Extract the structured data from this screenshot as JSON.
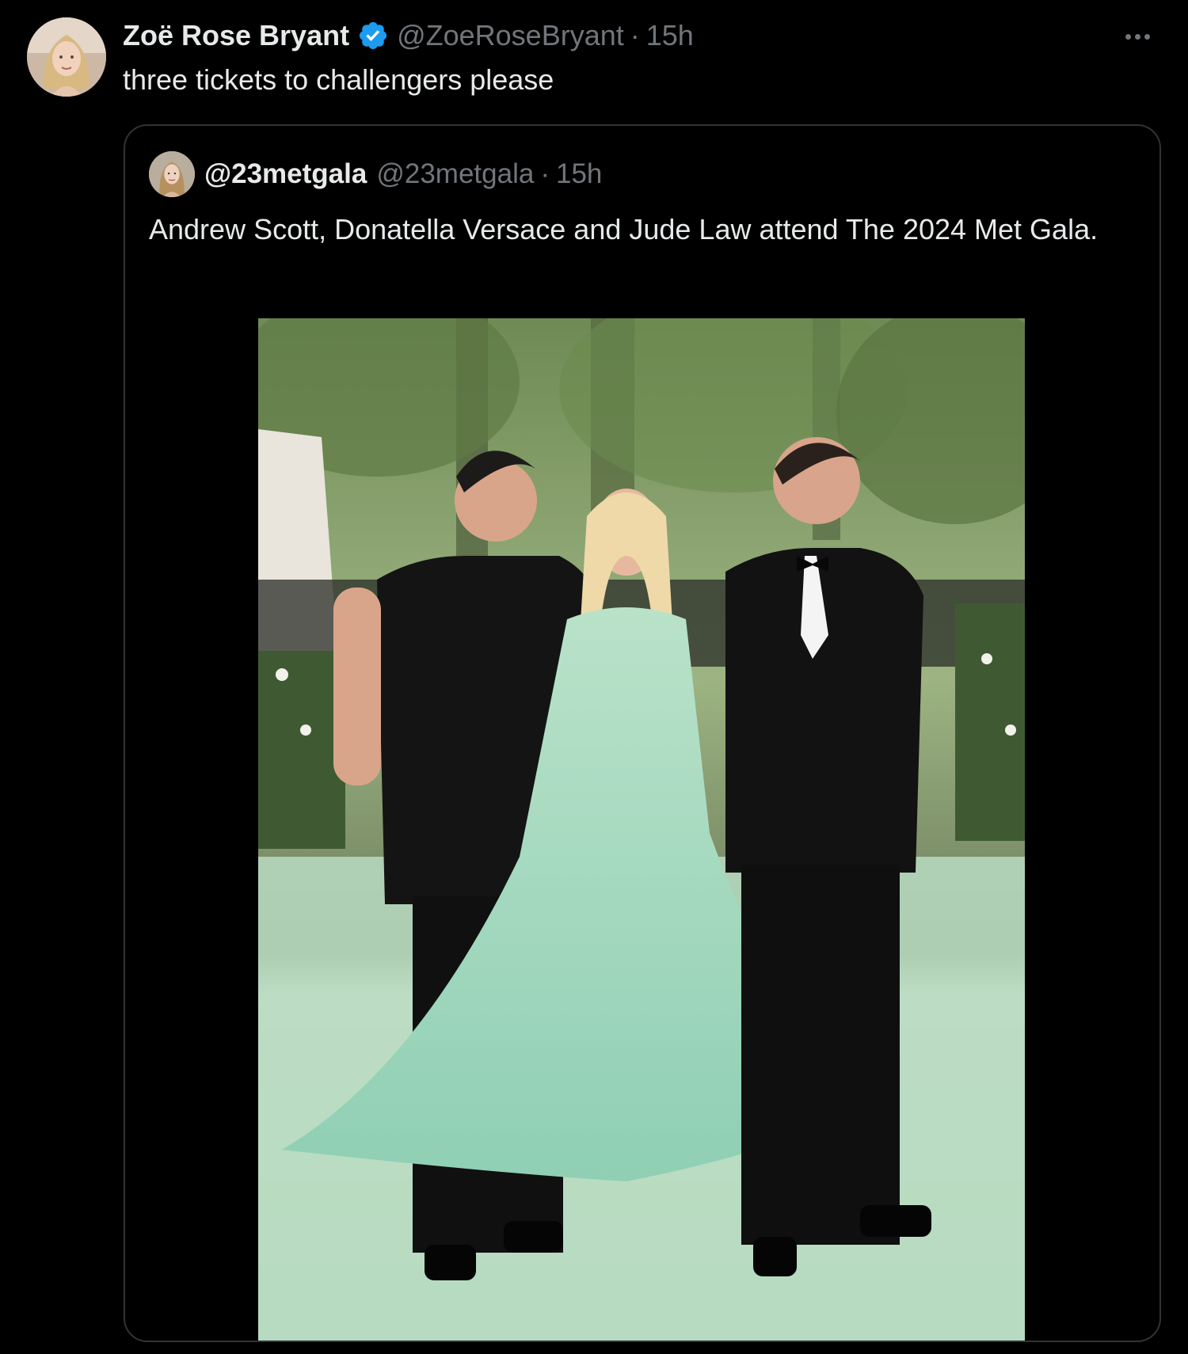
{
  "tweet": {
    "display_name": "Zoë Rose Bryant",
    "handle": "@ZoeRoseBryant",
    "separator": "·",
    "time": "15h",
    "text": "three tickets to challengers please",
    "verified": true,
    "more_icon": "more-horizontal-icon"
  },
  "quoted_tweet": {
    "display_name": "@23metgala",
    "handle": "@23metgala",
    "separator": "·",
    "time": "15h",
    "text": "Andrew Scott, Donatella Versace and Jude Law attend The 2024 Met Gala.",
    "media": {
      "type": "photo"
    }
  },
  "colors": {
    "background": "#000000",
    "text_primary": "#e7e9ea",
    "text_secondary": "#71767b",
    "border": "#2f3336",
    "verified_blue": "#1d9bf0"
  }
}
